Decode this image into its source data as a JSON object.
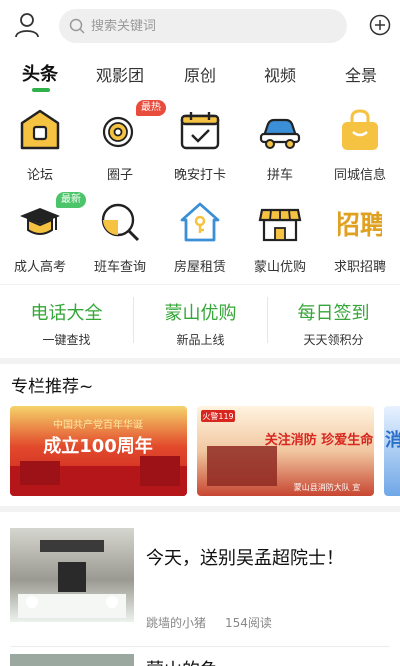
{
  "search": {
    "placeholder": "搜索关键词"
  },
  "tabs": [
    {
      "label": "头条"
    },
    {
      "label": "观影团"
    },
    {
      "label": "原创"
    },
    {
      "label": "视频"
    },
    {
      "label": "全景"
    }
  ],
  "grid": [
    {
      "label": "论坛",
      "icon": "forum-house-icon"
    },
    {
      "label": "圈子",
      "icon": "circle-disc-icon",
      "badge": "最热"
    },
    {
      "label": "晚安打卡",
      "icon": "calendar-check-icon"
    },
    {
      "label": "拼车",
      "icon": "car-icon"
    },
    {
      "label": "同城信息",
      "icon": "shopping-bag-icon"
    },
    {
      "label": "成人高考",
      "icon": "graduation-cap-icon",
      "badge": "最新"
    },
    {
      "label": "班车查询",
      "icon": "search-magnifier-icon"
    },
    {
      "label": "房屋租赁",
      "icon": "house-key-icon"
    },
    {
      "label": "蒙山优购",
      "icon": "shop-store-icon"
    },
    {
      "label": "求职招聘",
      "icon": "recruit-icon",
      "glyph": "招聘"
    }
  ],
  "badges": {
    "hot_color": "#e74c3c",
    "new_color": "#4cc46a"
  },
  "quick_links": [
    {
      "title": "电话大全",
      "subtitle": "一键查找"
    },
    {
      "title": "蒙山优购",
      "subtitle": "新品上线"
    },
    {
      "title": "每日签到",
      "subtitle": "天天领积分"
    }
  ],
  "section": {
    "title": "专栏推荐~"
  },
  "banners": [
    {
      "heading": "中国共产党百年华诞",
      "text": "成立100周年"
    },
    {
      "heading": "火警119",
      "text": "关注消防 珍爱生命",
      "footer": "蒙山县消防大队 宣"
    },
    {
      "heading": "消"
    }
  ],
  "feed": [
    {
      "title": "今天，送别吴孟超院士！",
      "author": "跳墙的小猪",
      "reads": "154阅读"
    },
    {
      "title": "蒙山的鱼"
    }
  ],
  "colors": {
    "accent": "#2fb24a",
    "quick_text": "#35a637",
    "icon_yellow": "#f5c242",
    "icon_blue": "#3a8fd6"
  }
}
